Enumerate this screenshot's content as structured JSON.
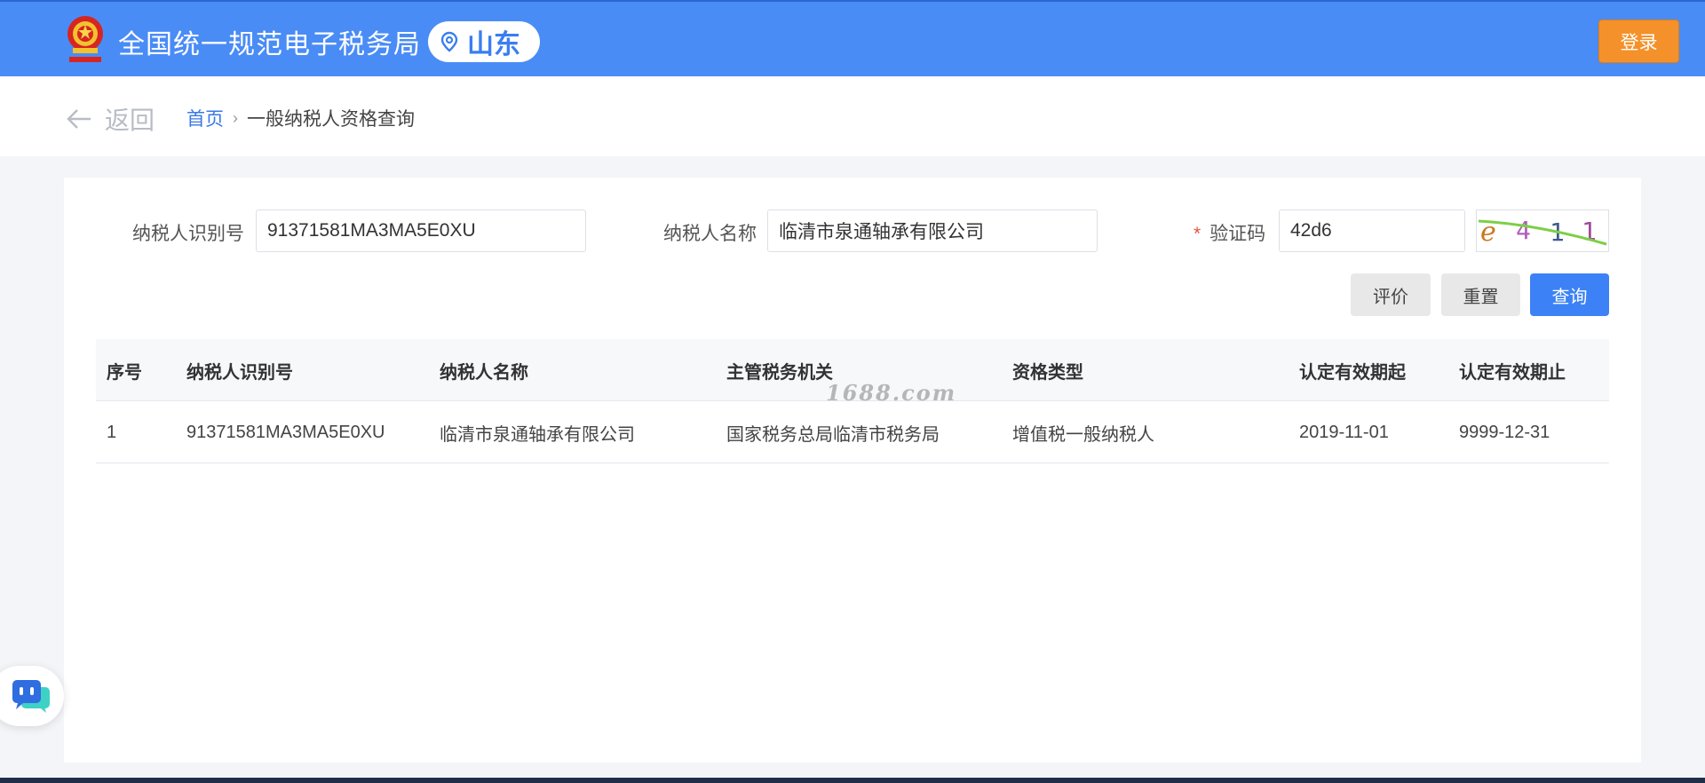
{
  "header": {
    "site_title": "全国统一规范电子税务局",
    "region": "山东",
    "login_label": "登录"
  },
  "nav": {
    "back_label": "返回",
    "home_label": "首页",
    "separator": "›",
    "current_page": "一般纳税人资格查询"
  },
  "form": {
    "taxpayer_id_label": "纳税人识别号",
    "taxpayer_id_value": "91371581MA3MA5E0XU",
    "taxpayer_name_label": "纳税人名称",
    "taxpayer_name_value": "临清市泉通轴承有限公司",
    "captcha_required_mark": "*",
    "captcha_label": "验证码",
    "captcha_value": "42d6",
    "captcha_image_text": "e411"
  },
  "buttons": {
    "evaluate": "评价",
    "reset": "重置",
    "query": "查询"
  },
  "table": {
    "columns": [
      "序号",
      "纳税人识别号",
      "纳税人名称",
      "主管税务机关",
      "资格类型",
      "认定有效期起",
      "认定有效期止"
    ],
    "rows": [
      [
        "1",
        "91371581MA3MA5E0XU",
        "临清市泉通轴承有限公司",
        "国家税务总局临清市税务局",
        "增值税一般纳税人",
        "2019-11-01",
        "9999-12-31"
      ]
    ]
  },
  "watermark": "1688.com",
  "icons": {
    "emblem": "national-emblem-icon",
    "region": "location-pin-icon",
    "back": "arrow-left-icon",
    "chat": "chat-bot-icon"
  },
  "colors": {
    "header_bg": "#4a8cf6",
    "login_bg": "#f4912a",
    "primary": "#3c82f6",
    "link": "#3a78e6"
  }
}
